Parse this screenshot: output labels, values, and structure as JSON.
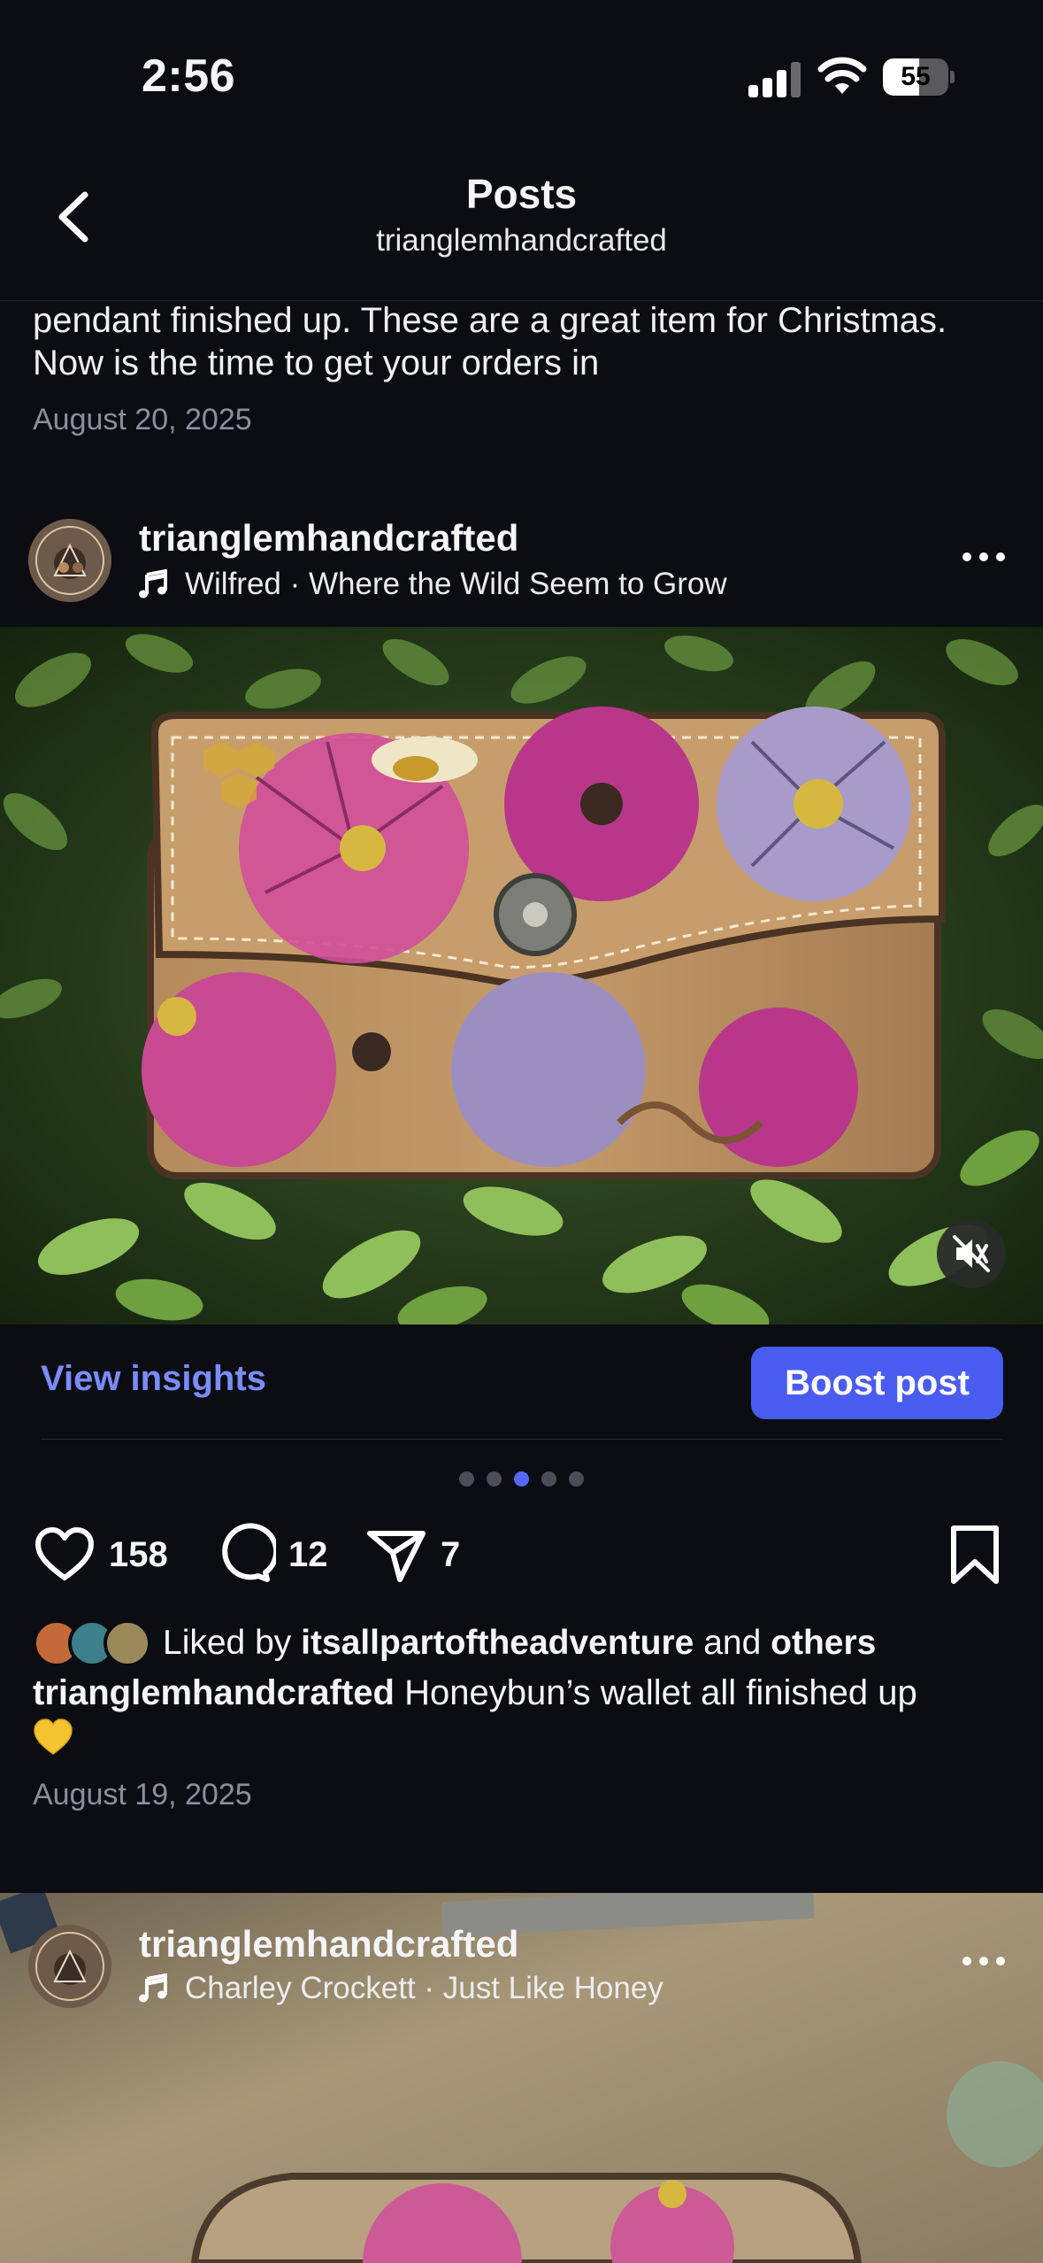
{
  "status_bar": {
    "time": "2:56",
    "battery_level": "55",
    "battery_fraction": 0.55
  },
  "header": {
    "title": "Posts",
    "subtitle": "trianglemhandcrafted"
  },
  "previous_post": {
    "caption": "pendant finished up. These are a great item for Christmas. Now is the time to get your orders in",
    "date": "August 20, 2025"
  },
  "post": {
    "username": "trianglemhandcrafted",
    "music": "Wilfred · Where the Wild Seem to Grow",
    "insights_label": "View insights",
    "boost_label": "Boost post",
    "carousel": {
      "count": 5,
      "active_index": 2
    },
    "likes_count": "158",
    "comments_count": "12",
    "shares_count": "7",
    "liked_by_prefix": "Liked by",
    "liked_by_user": "itsallpartoftheadventure",
    "liked_by_and": "and",
    "liked_by_others": "others",
    "caption_user": "trianglemhandcrafted",
    "caption_text": "Honeybun’s wallet all finished up",
    "date": "August 19, 2025"
  },
  "next_post": {
    "username": "trianglemhandcrafted",
    "music": "Charley Crockett · Just Like Honey"
  },
  "icons": {
    "back": "chevron-left-icon",
    "music": "music-note-icon",
    "more": "more-horizontal-icon",
    "mute": "speaker-muted-icon",
    "like": "heart-icon",
    "comment": "comment-bubble-icon",
    "share": "paper-plane-icon",
    "save": "bookmark-icon"
  },
  "colors": {
    "accent": "#4a5cf0",
    "link": "#7a8cff",
    "background": "#0b0d12"
  }
}
